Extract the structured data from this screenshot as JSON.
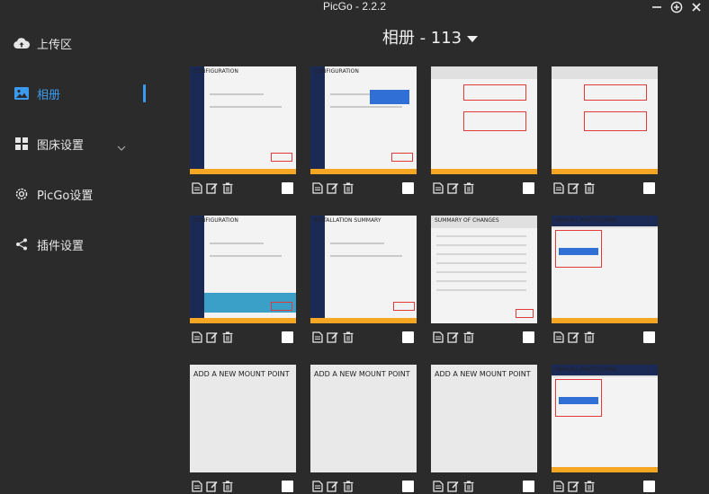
{
  "app": {
    "title": "PicGo - 2.2.2"
  },
  "sidebar": {
    "items": [
      {
        "label": "上传区",
        "icon": "cloud-upload-icon"
      },
      {
        "label": "相册",
        "icon": "image-icon",
        "active": true
      },
      {
        "label": "图床设置",
        "icon": "grid-icon"
      },
      {
        "label": "PicGo设置",
        "icon": "gear-icon"
      },
      {
        "label": "插件设置",
        "icon": "share-icon"
      }
    ]
  },
  "album": {
    "title": "相册 - 113"
  },
  "thumbs": [
    {
      "caption": "CONFIGURATION",
      "style": "centos"
    },
    {
      "caption": "CONFIGURATION",
      "style": "centos-sel"
    },
    {
      "caption": "",
      "style": "form"
    },
    {
      "caption": "",
      "style": "form2"
    },
    {
      "caption": "CONFIGURATION",
      "style": "centos-banner"
    },
    {
      "caption": "INSTALLATION SUMMARY",
      "style": "summary"
    },
    {
      "caption": "SUMMARY OF CHANGES",
      "style": "table"
    },
    {
      "caption": "MANUAL PARTITIONING",
      "style": "partition"
    },
    {
      "caption": "ADD A NEW MOUNT POINT",
      "style": "mount"
    },
    {
      "caption": "ADD A NEW MOUNT POINT",
      "style": "mount"
    },
    {
      "caption": "ADD A NEW MOUNT POINT",
      "style": "mount"
    },
    {
      "caption": "MANUAL PARTITIONING",
      "style": "partition"
    }
  ],
  "colors": {
    "accent": "#3a9bf0",
    "background": "#2b2b2b",
    "text": "#e6e6e6"
  }
}
